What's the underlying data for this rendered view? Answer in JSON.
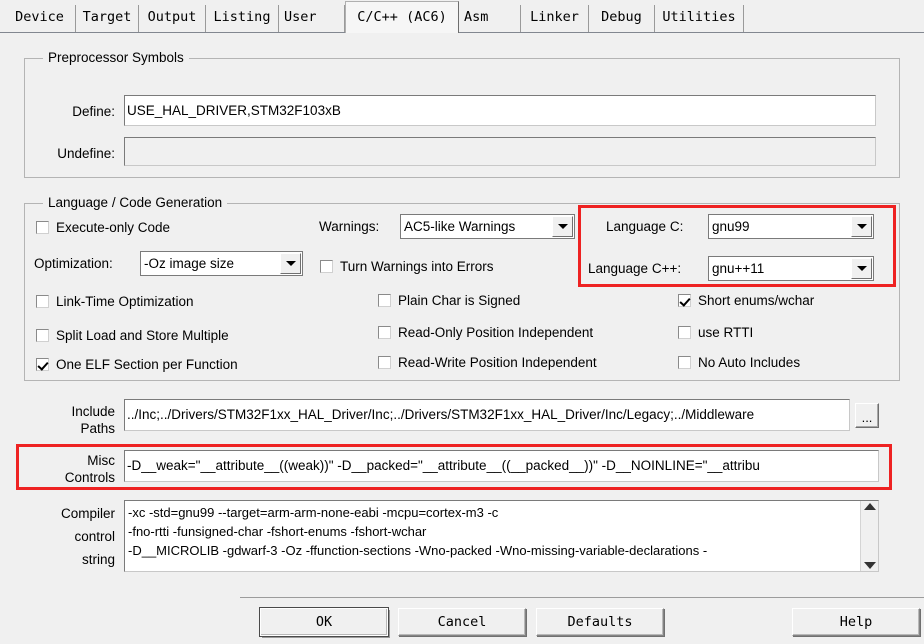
{
  "tabs": [
    {
      "label": "Device",
      "active": false
    },
    {
      "label": "Target",
      "active": false
    },
    {
      "label": "Output",
      "active": false
    },
    {
      "label": "Listing",
      "active": false
    },
    {
      "label": "User",
      "active": false
    },
    {
      "label": "C/C++ (AC6)",
      "active": true
    },
    {
      "label": "Asm",
      "active": false
    },
    {
      "label": "Linker",
      "active": false
    },
    {
      "label": "Debug",
      "active": false
    },
    {
      "label": "Utilities",
      "active": false
    }
  ],
  "preprocessor": {
    "title": "Preprocessor Symbols",
    "define_label": "Define:",
    "define_value": "USE_HAL_DRIVER,STM32F103xB",
    "undefine_label": "Undefine:",
    "undefine_value": ""
  },
  "language": {
    "title": "Language / Code Generation",
    "execute_only_code": {
      "label": "Execute-only Code",
      "checked": false
    },
    "optimization_label": "Optimization:",
    "optimization_value": "-Oz image size",
    "link_time_optimization": {
      "label": "Link-Time Optimization",
      "checked": false
    },
    "split_load_store": {
      "label": "Split Load and Store Multiple",
      "checked": false
    },
    "one_elf_section": {
      "label": "One ELF Section per Function",
      "checked": true
    },
    "warnings_label": "Warnings:",
    "warnings_value": "AC5-like Warnings",
    "turn_warnings_into_errors": {
      "label": "Turn Warnings into Errors",
      "checked": false
    },
    "plain_char_signed": {
      "label": "Plain Char is Signed",
      "checked": false
    },
    "read_only_pi": {
      "label": "Read-Only Position Independent",
      "checked": false
    },
    "read_write_pi": {
      "label": "Read-Write Position Independent",
      "checked": false
    },
    "language_c_label": "Language C:",
    "language_c_value": "gnu99",
    "language_cpp_label": "Language C++:",
    "language_cpp_value": "gnu++11",
    "short_enums_wchar": {
      "label": "Short enums/wchar",
      "checked": true
    },
    "use_rtti": {
      "label": "use RTTI",
      "checked": false
    },
    "no_auto_includes": {
      "label": "No Auto Includes",
      "checked": false
    }
  },
  "include_paths": {
    "label_line1": "Include",
    "label_line2": "Paths",
    "value": "../Inc;../Drivers/STM32F1xx_HAL_Driver/Inc;../Drivers/STM32F1xx_HAL_Driver/Inc/Legacy;../Middleware",
    "browse_label": "..."
  },
  "misc_controls": {
    "label_line1": "Misc",
    "label_line2": "Controls",
    "value": "-D__weak=\"__attribute__((weak))\" -D__packed=\"__attribute__((__packed__))\" -D__NOINLINE=\"__attribu"
  },
  "compiler_control_string": {
    "label_line1": "Compiler",
    "label_line2": "control",
    "label_line3": "string",
    "lines": [
      "-xc -std=gnu99 --target=arm-arm-none-eabi -mcpu=cortex-m3 -c",
      "-fno-rtti -funsigned-char -fshort-enums -fshort-wchar",
      "-D__MICROLIB -gdwarf-3 -Oz -ffunction-sections -Wno-packed -Wno-missing-variable-declarations -"
    ],
    "scroll_up_icon": "chevron-up-icon",
    "scroll_down_icon": "chevron-down-icon"
  },
  "buttons": {
    "ok": "OK",
    "cancel": "Cancel",
    "defaults": "Defaults",
    "help": "Help"
  },
  "annotations": {
    "highlight_color": "#ee2222",
    "boxes": [
      {
        "name": "language-selection-highlight"
      },
      {
        "name": "misc-controls-highlight"
      }
    ]
  }
}
